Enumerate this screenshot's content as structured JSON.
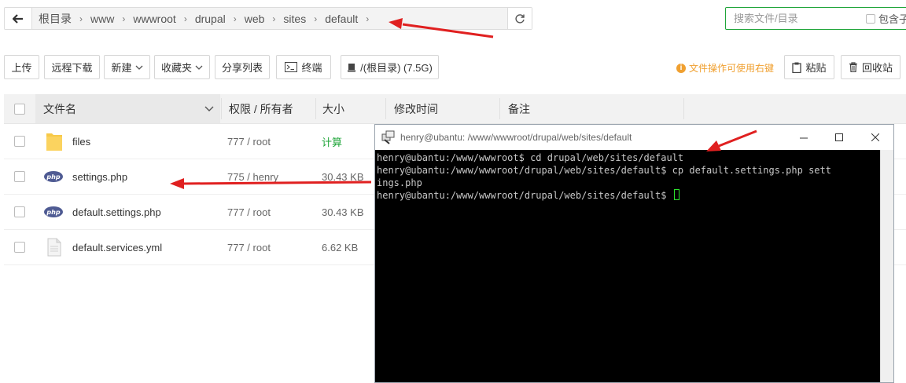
{
  "breadcrumb": {
    "items": [
      "根目录",
      "www",
      "wwwroot",
      "drupal",
      "web",
      "sites",
      "default"
    ],
    "separator": "›"
  },
  "search": {
    "placeholder": "搜索文件/目录",
    "include_sub_label": "包含子"
  },
  "toolbar": {
    "upload": "上传",
    "remote_download": "远程下载",
    "new": "新建",
    "favorites": "收藏夹",
    "share_list": "分享列表",
    "terminal": "终端",
    "disk": "/(根目录) (7.5G)",
    "tip": "文件操作可使用右键",
    "paste": "粘贴",
    "recycle": "回收站"
  },
  "table": {
    "headers": {
      "name": "文件名",
      "perm": "权限 / 所有者",
      "size": "大小",
      "mtime": "修改时间",
      "note": "备注"
    },
    "rows": [
      {
        "name": "files",
        "perm": "777 / root",
        "size": "计算",
        "icon": "folder-icon"
      },
      {
        "name": "settings.php",
        "perm": "775 / henry",
        "size": "30.43 KB",
        "icon": "php-file-icon"
      },
      {
        "name": "default.settings.php",
        "perm": "777 / root",
        "size": "30.43 KB",
        "icon": "php-file-icon"
      },
      {
        "name": "default.services.yml",
        "perm": "777 / root",
        "size": "6.62 KB",
        "icon": "document-icon"
      }
    ]
  },
  "terminal": {
    "title": "henry@ubantu: /www/wwwroot/drupal/web/sites/default",
    "lines": [
      "henry@ubantu:/www/wwwroot$ cd drupal/web/sites/default",
      "henry@ubantu:/www/wwwroot/drupal/web/sites/default$ cp default.settings.php sett",
      "ings.php",
      "henry@ubantu:/www/wwwroot/drupal/web/sites/default$ "
    ]
  },
  "colors": {
    "accent": "#20a53a",
    "warning": "#f0a030",
    "annotation_arrow": "#e02020"
  }
}
